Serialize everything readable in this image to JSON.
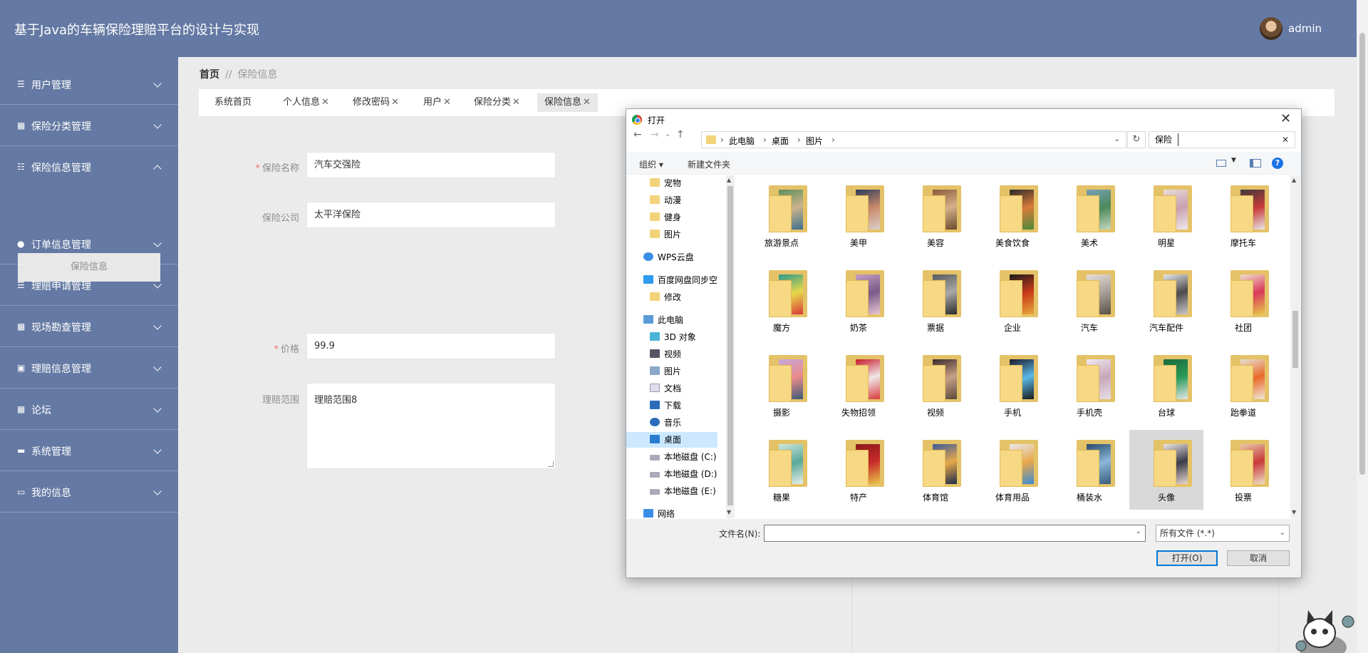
{
  "header": {
    "app_title": "基于Java的车辆保险理赔平台的设计与实现",
    "username": "admin"
  },
  "sidebar": {
    "items": [
      {
        "label": "用户管理",
        "icon": "list-icon"
      },
      {
        "label": "保险分类管理",
        "icon": "grid-icon"
      },
      {
        "label": "保险信息管理",
        "icon": "sliders-icon",
        "expanded": true
      },
      {
        "label": "订单信息管理",
        "icon": "person-icon"
      },
      {
        "label": "理赔申请管理",
        "icon": "list-icon"
      },
      {
        "label": "现场勘查管理",
        "icon": "grid-icon"
      },
      {
        "label": "理赔信息管理",
        "icon": "document-icon"
      },
      {
        "label": "论坛",
        "icon": "grid-icon"
      },
      {
        "label": "系统管理",
        "icon": "monitor-icon"
      },
      {
        "label": "我的信息",
        "icon": "card-icon"
      }
    ],
    "active_sub": "保险信息"
  },
  "breadcrumb": {
    "home": "首页",
    "separator": "//",
    "current": "保险信息"
  },
  "tabs": [
    {
      "label": "系统首页",
      "closable": false
    },
    {
      "label": "个人信息",
      "closable": true
    },
    {
      "label": "修改密码",
      "closable": true
    },
    {
      "label": "用户",
      "closable": true
    },
    {
      "label": "保险分类",
      "closable": true
    },
    {
      "label": "保险信息",
      "closable": true,
      "active": true
    }
  ],
  "form": {
    "name_label": "保险名称",
    "name_value": "汽车交强险",
    "company_label": "保险公司",
    "company_value": "太平洋保险",
    "price_label": "价格",
    "price_value": "99.9",
    "scope_label": "理赔范围",
    "scope_value": "理赔范围8",
    "required_mark": "*"
  },
  "dialog": {
    "title": "打开",
    "path": [
      "此电脑",
      "桌面",
      "图片"
    ],
    "search_value": "保险",
    "toolbar": {
      "organize": "组织",
      "new_folder": "新建文件夹"
    },
    "tree": [
      "宠物",
      "动漫",
      "健身",
      "图片",
      "WPS云盘",
      "百度网盘同步空间",
      "修改",
      "此电脑",
      "3D 对象",
      "视频",
      "图片",
      "文档",
      "下载",
      "音乐",
      "桌面",
      "本地磁盘 (C:)",
      "本地磁盘 (D:)",
      "本地磁盘 (E:)",
      "网络"
    ],
    "tree_selected": "桌面",
    "folders": [
      "旅游景点",
      "美甲",
      "美容",
      "美食饮食",
      "美术",
      "明星",
      "摩托车",
      "魔方",
      "奶茶",
      "票据",
      "企业",
      "汽车",
      "汽车配件",
      "社团",
      "摄影",
      "失物招领",
      "视频",
      "手机",
      "手机壳",
      "台球",
      "跆拳道",
      "糖果",
      "特产",
      "体育馆",
      "体育用品",
      "桶装水",
      "头像",
      "投票"
    ],
    "folder_selected": "头像",
    "filename_label": "文件名(N):",
    "filename_value": "",
    "filetype": "所有文件 (*.*)",
    "open_button": "打开(O)",
    "cancel_button": "取消"
  },
  "colors": {
    "sidebar": "#6479a3",
    "header": "#6479a3",
    "accent": "#0078d7",
    "required": "#f56c6c"
  }
}
